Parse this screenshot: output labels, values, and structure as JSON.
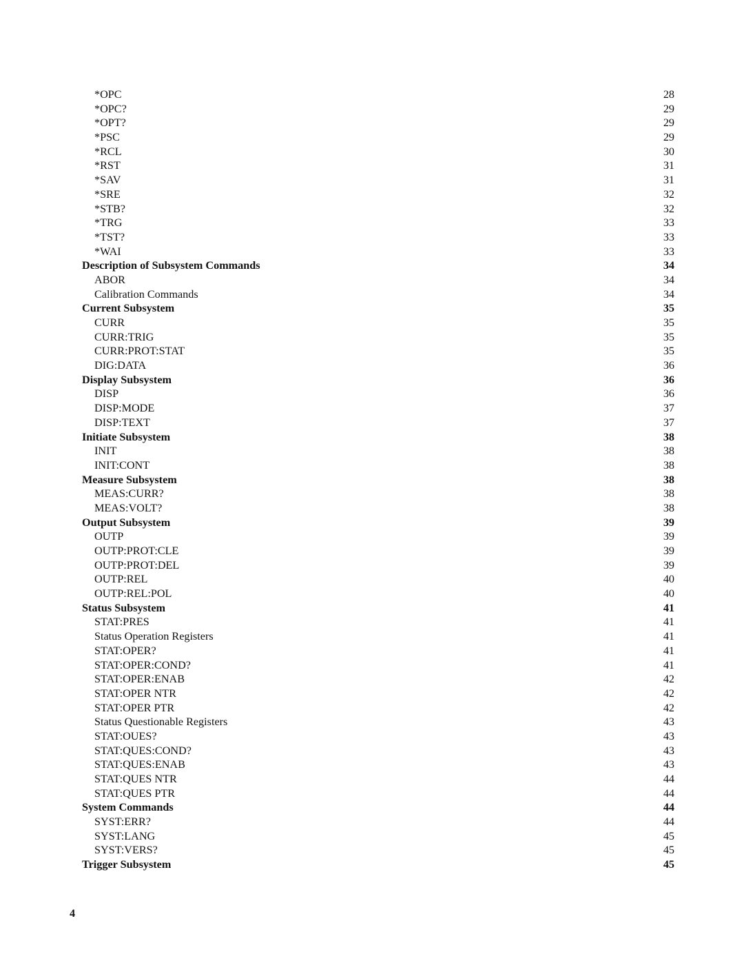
{
  "toc": {
    "entries": [
      {
        "label": "*OPC",
        "page": "28",
        "level": 2
      },
      {
        "label": "*OPC?",
        "page": "29",
        "level": 2
      },
      {
        "label": "*OPT?",
        "page": "29",
        "level": 2
      },
      {
        "label": "*PSC",
        "page": "29",
        "level": 2
      },
      {
        "label": "*RCL",
        "page": "30",
        "level": 2
      },
      {
        "label": "*RST",
        "page": "31",
        "level": 2
      },
      {
        "label": "*SAV",
        "page": "31",
        "level": 2
      },
      {
        "label": "*SRE",
        "page": "32",
        "level": 2
      },
      {
        "label": "*STB?",
        "page": "32",
        "level": 2
      },
      {
        "label": "*TRG",
        "page": "33",
        "level": 2
      },
      {
        "label": "*TST?",
        "page": "33",
        "level": 2
      },
      {
        "label": "*WAI",
        "page": "33",
        "level": 2
      },
      {
        "label": "Description of Subsystem Commands",
        "page": "34",
        "level": 1
      },
      {
        "label": "ABOR",
        "page": "34",
        "level": 2
      },
      {
        "label": "Calibration Commands",
        "page": "34",
        "level": 2
      },
      {
        "label": "Current Subsystem",
        "page": "35",
        "level": 1
      },
      {
        "label": "CURR",
        "page": "35",
        "level": 2
      },
      {
        "label": "CURR:TRIG",
        "page": "35",
        "level": 2
      },
      {
        "label": "CURR:PROT:STAT",
        "page": "35",
        "level": 2
      },
      {
        "label": "DIG:DATA",
        "page": "36",
        "level": 2
      },
      {
        "label": "Display Subsystem",
        "page": "36",
        "level": 1
      },
      {
        "label": "DISP",
        "page": "36",
        "level": 2
      },
      {
        "label": "DISP:MODE",
        "page": "37",
        "level": 2
      },
      {
        "label": "DISP:TEXT",
        "page": "37",
        "level": 2
      },
      {
        "label": "Initiate Subsystem",
        "page": "38",
        "level": 1
      },
      {
        "label": "INIT",
        "page": "38",
        "level": 2
      },
      {
        "label": "INIT:CONT",
        "page": "38",
        "level": 2
      },
      {
        "label": "Measure Subsystem",
        "page": "38",
        "level": 1
      },
      {
        "label": "MEAS:CURR?",
        "page": "38",
        "level": 2
      },
      {
        "label": "MEAS:VOLT?",
        "page": "38",
        "level": 2
      },
      {
        "label": "Output Subsystem",
        "page": "39",
        "level": 1
      },
      {
        "label": "OUTP",
        "page": "39",
        "level": 2
      },
      {
        "label": "OUTP:PROT:CLE",
        "page": "39",
        "level": 2
      },
      {
        "label": "OUTP:PROT:DEL",
        "page": "39",
        "level": 2
      },
      {
        "label": "OUTP:REL",
        "page": "40",
        "level": 2
      },
      {
        "label": "OUTP:REL:POL",
        "page": "40",
        "level": 2
      },
      {
        "label": "Status Subsystem",
        "page": "41",
        "level": 1
      },
      {
        "label": "STAT:PRES",
        "page": "41",
        "level": 2
      },
      {
        "label": "Status Operation Registers",
        "page": "41",
        "level": 2
      },
      {
        "label": "STAT:OPER?",
        "page": "41",
        "level": 2
      },
      {
        "label": "STAT:OPER:COND?",
        "page": "41",
        "level": 2
      },
      {
        "label": "STAT:OPER:ENAB",
        "page": "42",
        "level": 2
      },
      {
        "label": "STAT:OPER NTR",
        "page": "42",
        "level": 2
      },
      {
        "label": "STAT:OPER PTR",
        "page": "42",
        "level": 2
      },
      {
        "label": "Status Questionable Registers",
        "page": "43",
        "level": 2
      },
      {
        "label": "STAT:OUES?",
        "page": "43",
        "level": 2
      },
      {
        "label": "STAT:QUES:COND?",
        "page": "43",
        "level": 2
      },
      {
        "label": "STAT:QUES:ENAB",
        "page": "43",
        "level": 2
      },
      {
        "label": "STAT:QUES NTR",
        "page": "44",
        "level": 2
      },
      {
        "label": "STAT:QUES PTR",
        "page": "44",
        "level": 2
      },
      {
        "label": "System Commands",
        "page": "44",
        "level": 1
      },
      {
        "label": "SYST:ERR?",
        "page": "44",
        "level": 2
      },
      {
        "label": "SYST:LANG",
        "page": "45",
        "level": 2
      },
      {
        "label": "SYST:VERS?",
        "page": "45",
        "level": 2
      },
      {
        "label": "Trigger Subsystem",
        "page": "45",
        "level": 1
      }
    ]
  },
  "footer": {
    "page_number": "4"
  }
}
